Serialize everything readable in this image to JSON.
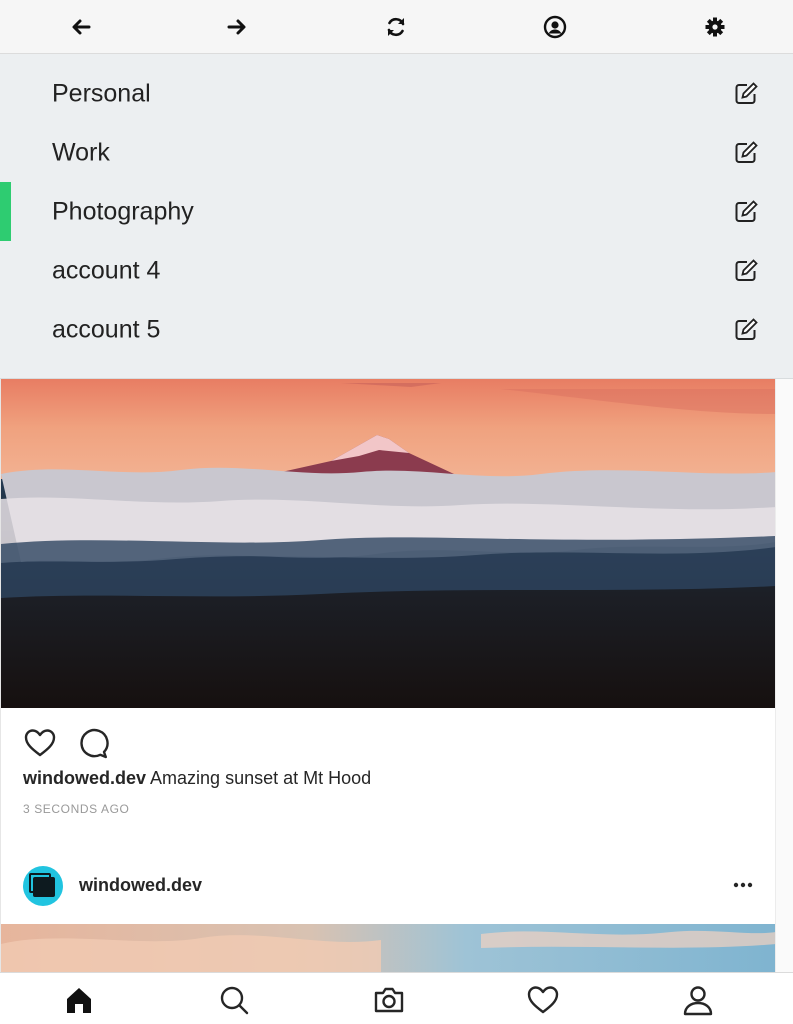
{
  "toolbar": {
    "icons": [
      "back-arrow-icon",
      "forward-arrow-icon",
      "refresh-icon",
      "account-icon",
      "settings-gear-icon"
    ]
  },
  "accounts": {
    "items": [
      {
        "label": "Personal",
        "active": false
      },
      {
        "label": "Work",
        "active": false
      },
      {
        "label": "Photography",
        "active": true
      },
      {
        "label": "account 4",
        "active": false
      },
      {
        "label": "account 5",
        "active": false
      }
    ],
    "active_color": "#2ecc71"
  },
  "feed": {
    "post1": {
      "username": "windowed.dev",
      "caption": "Amazing sunset at Mt Hood",
      "timestamp": "3 SECONDS AGO"
    },
    "post2": {
      "username": "windowed.dev"
    }
  },
  "bottom_nav": {
    "icons": [
      "home-icon",
      "search-icon",
      "camera-icon",
      "heart-icon",
      "profile-icon"
    ]
  }
}
